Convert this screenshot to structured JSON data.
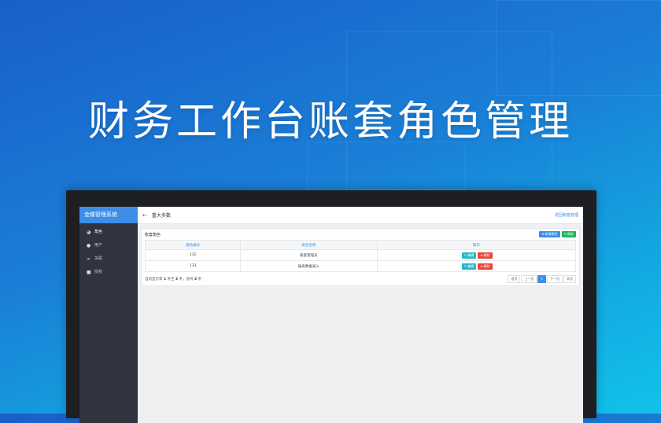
{
  "banner": {
    "title": "财务工作台账套角色管理"
  },
  "app": {
    "sidebar_title": "金蝶管理系统",
    "menu": [
      {
        "label": "角色",
        "icon": "palette-icon",
        "active": true
      },
      {
        "label": "用户",
        "icon": "user-icon",
        "active": false
      },
      {
        "label": "关联",
        "icon": "link-icon",
        "active": false
      },
      {
        "label": "授权",
        "icon": "lock-icon",
        "active": false
      }
    ],
    "topbar": {
      "back_title": "重大多数",
      "right_link": "返回账套管理"
    },
    "panel": {
      "title": "账套角色",
      "add_button": "新增角色",
      "refresh_button": "刷新",
      "columns": [
        "角色编号",
        "角色名称",
        "操作"
      ],
      "rows": [
        {
          "code": "132",
          "name": "账套管理员"
        },
        {
          "code": "133",
          "name": "报表数据录入"
        }
      ],
      "edit_label": "编辑",
      "delete_label": "删除",
      "summary": {
        "prefix": "当前显示第",
        "start": "1",
        "mid": "条至",
        "end": "2",
        "mid2": "条，总共",
        "total": "2",
        "suffix": "条"
      },
      "pagination": [
        "首页",
        "上一页",
        "1",
        "下一页",
        "末页"
      ]
    }
  }
}
